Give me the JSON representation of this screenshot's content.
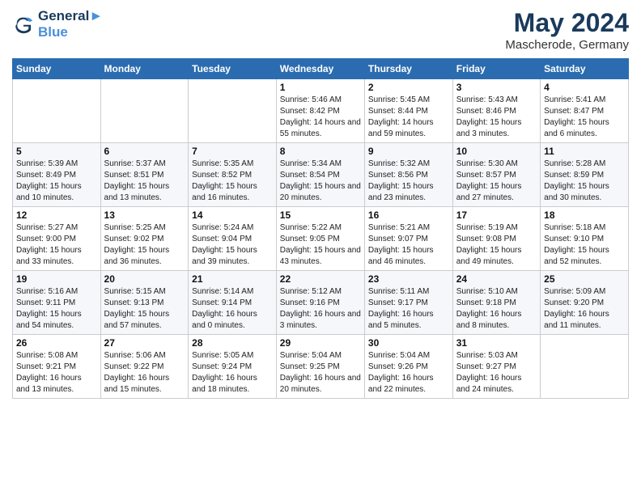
{
  "header": {
    "logo_line1": "General",
    "logo_line2": "Blue",
    "month": "May 2024",
    "location": "Mascherode, Germany"
  },
  "weekdays": [
    "Sunday",
    "Monday",
    "Tuesday",
    "Wednesday",
    "Thursday",
    "Friday",
    "Saturday"
  ],
  "weeks": [
    [
      {
        "day": "",
        "sunrise": "",
        "sunset": "",
        "daylight": ""
      },
      {
        "day": "",
        "sunrise": "",
        "sunset": "",
        "daylight": ""
      },
      {
        "day": "",
        "sunrise": "",
        "sunset": "",
        "daylight": ""
      },
      {
        "day": "1",
        "sunrise": "Sunrise: 5:46 AM",
        "sunset": "Sunset: 8:42 PM",
        "daylight": "Daylight: 14 hours and 55 minutes."
      },
      {
        "day": "2",
        "sunrise": "Sunrise: 5:45 AM",
        "sunset": "Sunset: 8:44 PM",
        "daylight": "Daylight: 14 hours and 59 minutes."
      },
      {
        "day": "3",
        "sunrise": "Sunrise: 5:43 AM",
        "sunset": "Sunset: 8:46 PM",
        "daylight": "Daylight: 15 hours and 3 minutes."
      },
      {
        "day": "4",
        "sunrise": "Sunrise: 5:41 AM",
        "sunset": "Sunset: 8:47 PM",
        "daylight": "Daylight: 15 hours and 6 minutes."
      }
    ],
    [
      {
        "day": "5",
        "sunrise": "Sunrise: 5:39 AM",
        "sunset": "Sunset: 8:49 PM",
        "daylight": "Daylight: 15 hours and 10 minutes."
      },
      {
        "day": "6",
        "sunrise": "Sunrise: 5:37 AM",
        "sunset": "Sunset: 8:51 PM",
        "daylight": "Daylight: 15 hours and 13 minutes."
      },
      {
        "day": "7",
        "sunrise": "Sunrise: 5:35 AM",
        "sunset": "Sunset: 8:52 PM",
        "daylight": "Daylight: 15 hours and 16 minutes."
      },
      {
        "day": "8",
        "sunrise": "Sunrise: 5:34 AM",
        "sunset": "Sunset: 8:54 PM",
        "daylight": "Daylight: 15 hours and 20 minutes."
      },
      {
        "day": "9",
        "sunrise": "Sunrise: 5:32 AM",
        "sunset": "Sunset: 8:56 PM",
        "daylight": "Daylight: 15 hours and 23 minutes."
      },
      {
        "day": "10",
        "sunrise": "Sunrise: 5:30 AM",
        "sunset": "Sunset: 8:57 PM",
        "daylight": "Daylight: 15 hours and 27 minutes."
      },
      {
        "day": "11",
        "sunrise": "Sunrise: 5:28 AM",
        "sunset": "Sunset: 8:59 PM",
        "daylight": "Daylight: 15 hours and 30 minutes."
      }
    ],
    [
      {
        "day": "12",
        "sunrise": "Sunrise: 5:27 AM",
        "sunset": "Sunset: 9:00 PM",
        "daylight": "Daylight: 15 hours and 33 minutes."
      },
      {
        "day": "13",
        "sunrise": "Sunrise: 5:25 AM",
        "sunset": "Sunset: 9:02 PM",
        "daylight": "Daylight: 15 hours and 36 minutes."
      },
      {
        "day": "14",
        "sunrise": "Sunrise: 5:24 AM",
        "sunset": "Sunset: 9:04 PM",
        "daylight": "Daylight: 15 hours and 39 minutes."
      },
      {
        "day": "15",
        "sunrise": "Sunrise: 5:22 AM",
        "sunset": "Sunset: 9:05 PM",
        "daylight": "Daylight: 15 hours and 43 minutes."
      },
      {
        "day": "16",
        "sunrise": "Sunrise: 5:21 AM",
        "sunset": "Sunset: 9:07 PM",
        "daylight": "Daylight: 15 hours and 46 minutes."
      },
      {
        "day": "17",
        "sunrise": "Sunrise: 5:19 AM",
        "sunset": "Sunset: 9:08 PM",
        "daylight": "Daylight: 15 hours and 49 minutes."
      },
      {
        "day": "18",
        "sunrise": "Sunrise: 5:18 AM",
        "sunset": "Sunset: 9:10 PM",
        "daylight": "Daylight: 15 hours and 52 minutes."
      }
    ],
    [
      {
        "day": "19",
        "sunrise": "Sunrise: 5:16 AM",
        "sunset": "Sunset: 9:11 PM",
        "daylight": "Daylight: 15 hours and 54 minutes."
      },
      {
        "day": "20",
        "sunrise": "Sunrise: 5:15 AM",
        "sunset": "Sunset: 9:13 PM",
        "daylight": "Daylight: 15 hours and 57 minutes."
      },
      {
        "day": "21",
        "sunrise": "Sunrise: 5:14 AM",
        "sunset": "Sunset: 9:14 PM",
        "daylight": "Daylight: 16 hours and 0 minutes."
      },
      {
        "day": "22",
        "sunrise": "Sunrise: 5:12 AM",
        "sunset": "Sunset: 9:16 PM",
        "daylight": "Daylight: 16 hours and 3 minutes."
      },
      {
        "day": "23",
        "sunrise": "Sunrise: 5:11 AM",
        "sunset": "Sunset: 9:17 PM",
        "daylight": "Daylight: 16 hours and 5 minutes."
      },
      {
        "day": "24",
        "sunrise": "Sunrise: 5:10 AM",
        "sunset": "Sunset: 9:18 PM",
        "daylight": "Daylight: 16 hours and 8 minutes."
      },
      {
        "day": "25",
        "sunrise": "Sunrise: 5:09 AM",
        "sunset": "Sunset: 9:20 PM",
        "daylight": "Daylight: 16 hours and 11 minutes."
      }
    ],
    [
      {
        "day": "26",
        "sunrise": "Sunrise: 5:08 AM",
        "sunset": "Sunset: 9:21 PM",
        "daylight": "Daylight: 16 hours and 13 minutes."
      },
      {
        "day": "27",
        "sunrise": "Sunrise: 5:06 AM",
        "sunset": "Sunset: 9:22 PM",
        "daylight": "Daylight: 16 hours and 15 minutes."
      },
      {
        "day": "28",
        "sunrise": "Sunrise: 5:05 AM",
        "sunset": "Sunset: 9:24 PM",
        "daylight": "Daylight: 16 hours and 18 minutes."
      },
      {
        "day": "29",
        "sunrise": "Sunrise: 5:04 AM",
        "sunset": "Sunset: 9:25 PM",
        "daylight": "Daylight: 16 hours and 20 minutes."
      },
      {
        "day": "30",
        "sunrise": "Sunrise: 5:04 AM",
        "sunset": "Sunset: 9:26 PM",
        "daylight": "Daylight: 16 hours and 22 minutes."
      },
      {
        "day": "31",
        "sunrise": "Sunrise: 5:03 AM",
        "sunset": "Sunset: 9:27 PM",
        "daylight": "Daylight: 16 hours and 24 minutes."
      },
      {
        "day": "",
        "sunrise": "",
        "sunset": "",
        "daylight": ""
      }
    ]
  ]
}
